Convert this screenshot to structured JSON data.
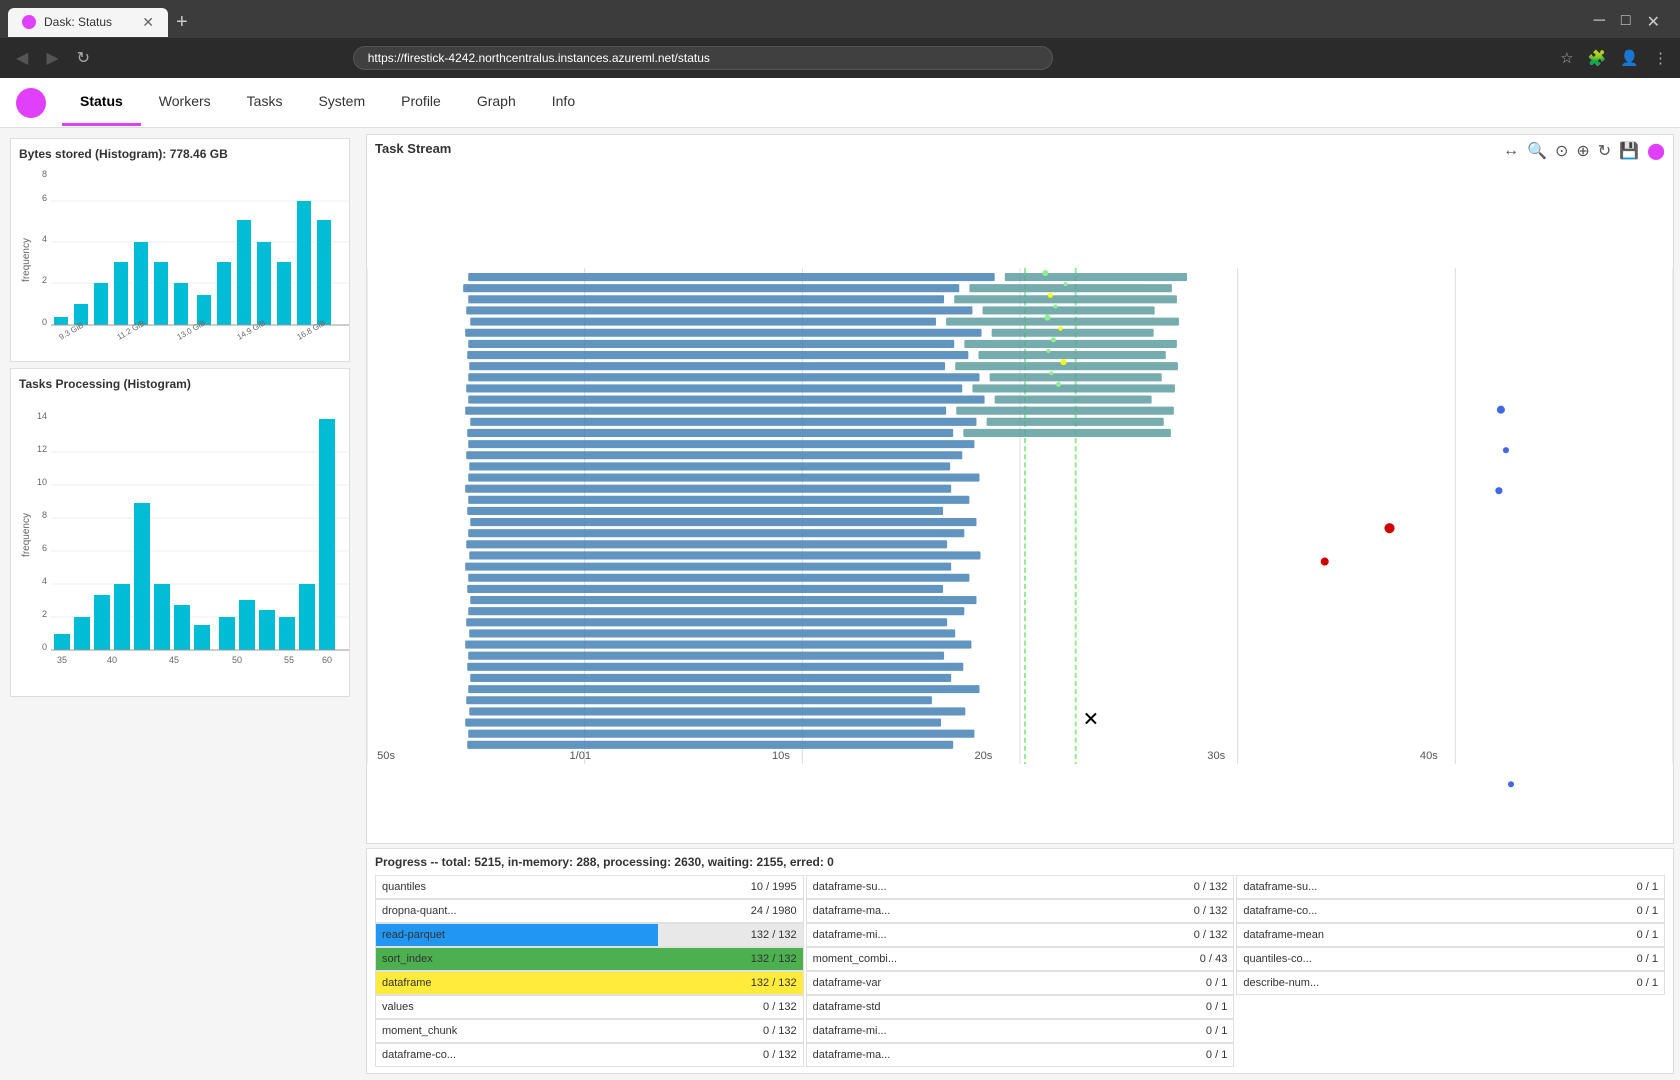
{
  "browser": {
    "tab_title": "Dask: Status",
    "url": "https://firestick-4242.northcentralus.instances.azureml.net/status",
    "new_tab_label": "+"
  },
  "nav": {
    "items": [
      "Status",
      "Workers",
      "Tasks",
      "System",
      "Profile",
      "Graph",
      "Info"
    ],
    "active": "Status"
  },
  "bytes_histogram": {
    "title": "Bytes stored (Histogram): 778.46 GB",
    "y_axis": [
      0,
      2,
      4,
      6,
      8
    ],
    "x_axis": [
      "9.3 GiB",
      "11.2 GiB",
      "13.0 GiB",
      "14.9 GiB",
      "16.8 GiB"
    ],
    "y_label": "frequency"
  },
  "tasks_histogram": {
    "title": "Tasks Processing (Histogram)",
    "y_axis": [
      0,
      2,
      4,
      6,
      8,
      10,
      12,
      14
    ],
    "x_axis": [
      "35",
      "40",
      "45",
      "50",
      "55",
      "60"
    ],
    "y_label": "frequency"
  },
  "task_stream": {
    "title": "Task Stream",
    "x_axis": [
      "50s",
      "1/01",
      "10s",
      "20s",
      "30s",
      "40s"
    ]
  },
  "progress": {
    "title": "Progress -- total: 5215, in-memory: 288, processing: 2630, waiting: 2155, erred: 0",
    "items_col1": [
      {
        "name": "quantiles",
        "count": "10 / 1995",
        "style": ""
      },
      {
        "name": "dropna-quant...",
        "count": "24 / 1980",
        "style": ""
      },
      {
        "name": "read-parquet",
        "count": "132 / 132",
        "style": "partial-blue"
      },
      {
        "name": "sort_index",
        "count": "132 / 132",
        "style": "green"
      },
      {
        "name": "dataframe",
        "count": "132 / 132",
        "style": "yellow"
      },
      {
        "name": "values",
        "count": "0 / 132",
        "style": ""
      },
      {
        "name": "moment_chunk",
        "count": "0 / 132",
        "style": ""
      },
      {
        "name": "dataframe-co...",
        "count": "0 / 132",
        "style": ""
      }
    ],
    "items_col2": [
      {
        "name": "dataframe-su...",
        "count": "0 / 132",
        "style": ""
      },
      {
        "name": "dataframe-ma...",
        "count": "0 / 132",
        "style": ""
      },
      {
        "name": "dataframe-mi...",
        "count": "0 / 132",
        "style": ""
      },
      {
        "name": "moment_combi...",
        "count": "0 / 43",
        "style": ""
      },
      {
        "name": "dataframe-var",
        "count": "0 / 1",
        "style": ""
      },
      {
        "name": "dataframe-std",
        "count": "0 / 1",
        "style": ""
      },
      {
        "name": "dataframe-mi...",
        "count": "0 / 1",
        "style": ""
      },
      {
        "name": "dataframe-ma...",
        "count": "0 / 1",
        "style": ""
      }
    ],
    "items_col3": [
      {
        "name": "dataframe-su...",
        "count": "0 / 1",
        "style": ""
      },
      {
        "name": "dataframe-co...",
        "count": "0 / 1",
        "style": ""
      },
      {
        "name": "dataframe-mean",
        "count": "0 / 1",
        "style": ""
      },
      {
        "name": "quantiles-co...",
        "count": "0 / 1",
        "style": ""
      },
      {
        "name": "describe-num...",
        "count": "0 / 1",
        "style": ""
      }
    ]
  }
}
